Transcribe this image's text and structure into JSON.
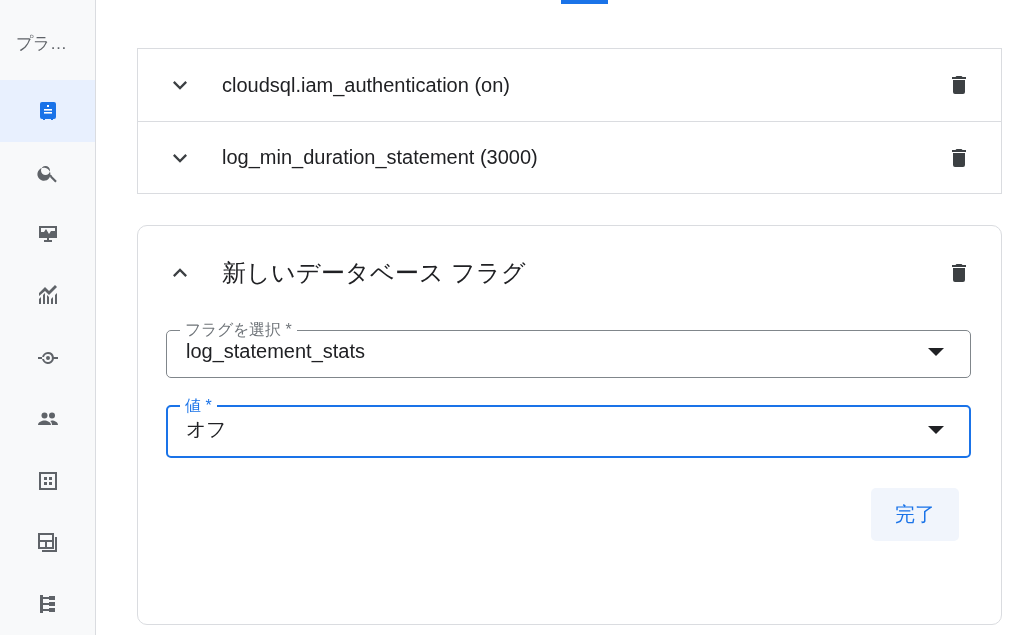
{
  "sidebar": {
    "title": "プラ…",
    "items": [
      {
        "kind": "instance",
        "selected": true
      },
      {
        "kind": "search",
        "selected": false
      },
      {
        "kind": "monitor",
        "selected": false
      },
      {
        "kind": "chart",
        "selected": false
      },
      {
        "kind": "connection",
        "selected": false
      },
      {
        "kind": "users",
        "selected": false
      },
      {
        "kind": "grid",
        "selected": false
      },
      {
        "kind": "layers",
        "selected": false
      },
      {
        "kind": "tree",
        "selected": false
      }
    ]
  },
  "flags": [
    {
      "label": "cloudsql.iam_authentication (on)",
      "expanded": false
    },
    {
      "label": "log_min_duration_statement (3000)",
      "expanded": false
    }
  ],
  "new_flag": {
    "title": "新しいデータベース フラグ",
    "expanded": true,
    "fields": [
      {
        "label": "フラグを選択 *",
        "value": "log_statement_stats",
        "focused": false
      },
      {
        "label": "値 *",
        "value": "オフ",
        "focused": true
      }
    ],
    "done_button": "完了"
  }
}
